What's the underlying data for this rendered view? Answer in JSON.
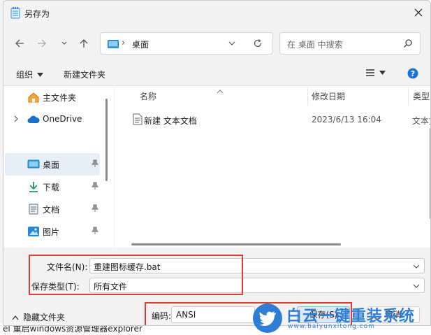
{
  "window": {
    "title": "另存为"
  },
  "nav": {
    "location": "桌面",
    "search_placeholder": "在 桌面 中搜索"
  },
  "toolbar": {
    "organize": "组织",
    "new_folder": "新建文件夹"
  },
  "sidebar": {
    "items": [
      {
        "label": "主文件夹",
        "icon": "home-icon"
      },
      {
        "label": "OneDrive",
        "icon": "cloud-icon"
      },
      {
        "label": "桌面",
        "icon": "desktop-icon"
      },
      {
        "label": "下载",
        "icon": "download-icon"
      },
      {
        "label": "文档",
        "icon": "document-icon"
      },
      {
        "label": "图片",
        "icon": "picture-icon"
      }
    ]
  },
  "columns": {
    "name": "名称",
    "modified": "修改日期",
    "type": "类型"
  },
  "files": [
    {
      "name": "新建 文本文档",
      "modified": "2023/6/13 16:04",
      "type": "文本文"
    }
  ],
  "form": {
    "filename_label": "文件名(N):",
    "filename_value": "重建图标缓存.bat",
    "filetype_label": "保存类型(T):",
    "filetype_value": "所有文件"
  },
  "footer": {
    "hide_folders": "隐藏文件夹",
    "encoding_label": "编码:",
    "encoding_value": "ANSI",
    "save": "保存(S)",
    "cancel": "取消"
  },
  "watermark": {
    "text": "白云一键重装系统",
    "url": "www.baiyunxitong.com"
  },
  "background_text": "el 重启windows资源管理器explorer",
  "colors": {
    "highlight": "#e23b3b",
    "accent": "#2e7ed6",
    "selected": "#e6eef8"
  }
}
